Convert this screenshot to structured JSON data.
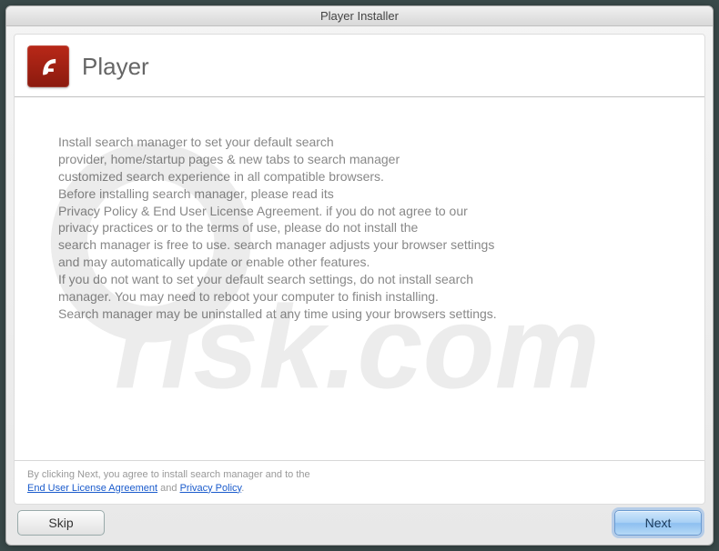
{
  "window": {
    "title": "Player Installer"
  },
  "header": {
    "title": "Player"
  },
  "body": {
    "text": "Install search manager to set your default search\nprovider, home/startup pages & new tabs to search manager\ncustomized search experience in all compatible browsers.\nBefore installing search manager, please read its\nPrivacy Policy & End User License Agreement. if you do not agree to our\nprivacy practices or to the terms of use, please do not install the\nsearch manager is free to use. search manager adjusts your browser settings\nand may automatically update or enable other features.\nIf you do not want to set your default search settings, do not install search\nmanager. You may need to reboot your computer to finish installing.\nSearch manager may be uninstalled at any time using your browsers settings."
  },
  "footer": {
    "prefix": "By clicking Next, you agree to install search manager and to the",
    "eula": "End User License Agreement",
    "conj": " and ",
    "privacy": "Privacy Policy",
    "suffix": "."
  },
  "buttons": {
    "skip": "Skip",
    "next": "Next"
  }
}
